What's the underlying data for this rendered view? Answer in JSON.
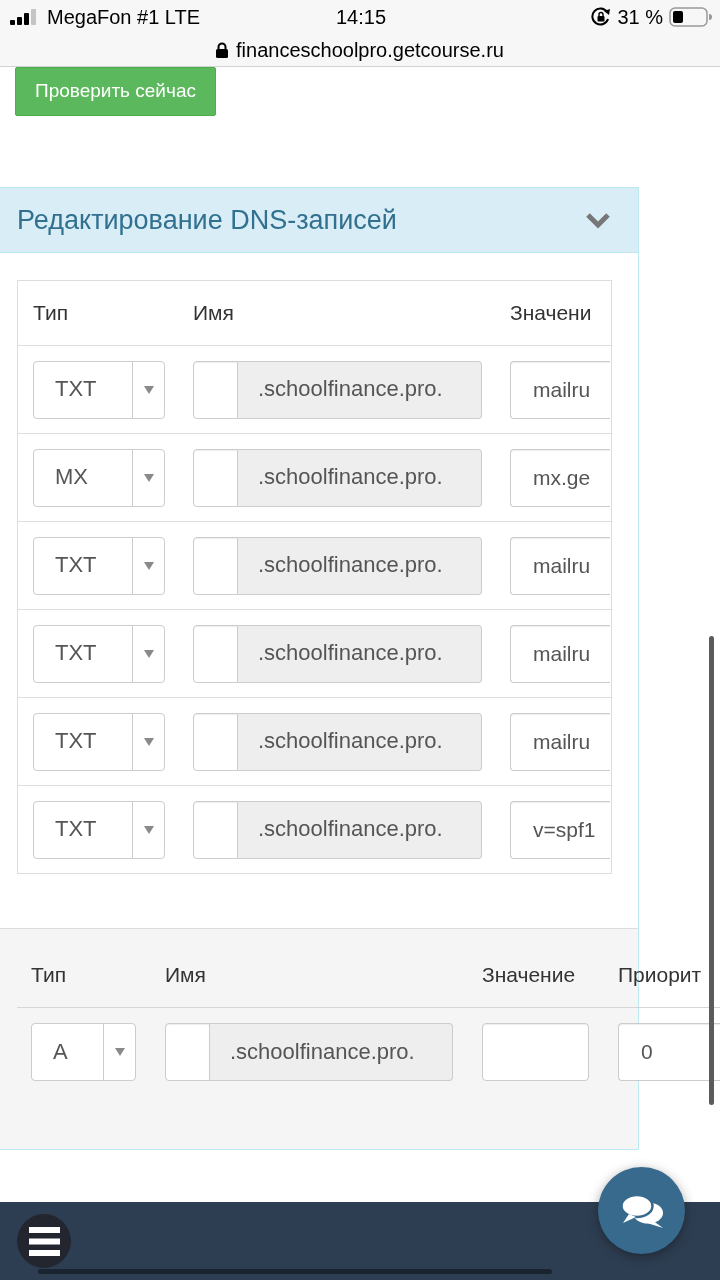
{
  "status_bar": {
    "carrier": "MegaFon #1 LTE",
    "time": "14:15",
    "battery": "31 %"
  },
  "address_bar": {
    "url": "financeschoolpro.getcourse.ru"
  },
  "check_button": {
    "label": "Проверить сейчас"
  },
  "dns_panel": {
    "title": "Редактирование DNS-записей",
    "table": {
      "columns": [
        "Тип",
        "Имя",
        "Значени"
      ],
      "rows": [
        {
          "type": "TXT",
          "domain": ".schoolfinance.pro.",
          "value": "mailru"
        },
        {
          "type": "MX",
          "domain": ".schoolfinance.pro.",
          "value": "mx.ge"
        },
        {
          "type": "TXT",
          "domain": ".schoolfinance.pro.",
          "value": "mailru"
        },
        {
          "type": "TXT",
          "domain": ".schoolfinance.pro.",
          "value": "mailru"
        },
        {
          "type": "TXT",
          "domain": ".schoolfinance.pro.",
          "value": "mailru"
        },
        {
          "type": "TXT",
          "domain": ".schoolfinance.pro.",
          "value": "v=spf1"
        }
      ]
    },
    "new_record": {
      "columns": [
        "Тип",
        "Имя",
        "Значение",
        "Приорит"
      ],
      "type": "A",
      "domain": ".schoolfinance.pro.",
      "priority": "0"
    }
  }
}
